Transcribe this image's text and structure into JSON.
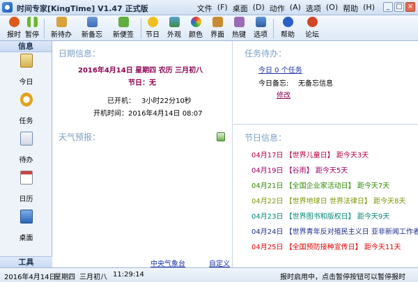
{
  "window": {
    "title": "时间专家[KingTime] V1.47 正式版",
    "menu": [
      "文件",
      "桌面",
      "动作",
      "选项",
      "帮助"
    ],
    "controls": {
      "minimize": "_",
      "maximize": "□",
      "close": "×"
    }
  },
  "toolbar": {
    "buttons": [
      {
        "label": "报时",
        "icon": "clock-icon"
      },
      {
        "label": "暂停",
        "icon": "pause-icon"
      },
      {
        "label": "新待办",
        "icon": "new-todo-icon"
      },
      {
        "label": "新备忘",
        "icon": "new-memo-icon"
      },
      {
        "label": "新便签",
        "icon": "new-note-icon"
      },
      {
        "label": "节日",
        "icon": "festival-icon"
      },
      {
        "label": "外观",
        "icon": "appearance-icon"
      },
      {
        "label": "颜色",
        "icon": "palette-icon"
      },
      {
        "label": "界面",
        "icon": "interface-icon"
      },
      {
        "label": "热键",
        "icon": "hotkey-icon"
      },
      {
        "label": "选项",
        "icon": "options-icon"
      },
      {
        "label": "帮助",
        "icon": "help-icon"
      },
      {
        "label": "论坛",
        "icon": "forum-icon"
      }
    ]
  },
  "sidebar": {
    "header": "信息",
    "footer": "工具",
    "items": [
      {
        "label": "今日",
        "icon": "clipboard-icon"
      },
      {
        "label": "任务",
        "icon": "clock-task-icon"
      },
      {
        "label": "待办",
        "icon": "todo-icon"
      },
      {
        "label": "日历",
        "icon": "calendar-icon"
      },
      {
        "label": "桌面",
        "icon": "desktop-icon"
      }
    ]
  },
  "date_panel": {
    "title": "日期信息：",
    "date_line": "2016年4月14日  星期四   农历  三月初八",
    "holiday_line": "节日：无",
    "uptime_label": "已开机：",
    "uptime_value": "3小时22分10秒",
    "boot_label": "开机时间：",
    "boot_value": "2016年4月14日  08:07",
    "weather_title": "天气预报：",
    "weather_link": "中央气象台",
    "custom_link": "自定义"
  },
  "task_panel": {
    "title": "任务待办：",
    "today_tasks_link": "今日  0  个任务",
    "memo_label": "今日备忘:",
    "memo_value": "无备忘信息",
    "edit_link": "修改"
  },
  "holiday_panel": {
    "title": "节日信息：",
    "items": [
      {
        "date": "04月17日",
        "name": "【世界儿童日】",
        "countdown": "距今天3天",
        "color": "#b0003a"
      },
      {
        "date": "04月19日",
        "name": "【谷雨】",
        "countdown": "距今天5天",
        "color": "#9b0069"
      },
      {
        "date": "04月21日",
        "name": "【全国企业家活动日】",
        "countdown": "距今天7天",
        "color": "#2e8a00"
      },
      {
        "date": "04月22日",
        "name": "【世界地球日  世界法律日】",
        "countdown": "距今天8天",
        "color": "#7c9400"
      },
      {
        "date": "04月23日",
        "name": "【世界图书和版权日】",
        "countdown": "距今天9天",
        "color": "#008878"
      },
      {
        "date": "04月24日",
        "name": "【世界青年反对殖民主义日  亚非新闻工作者",
        "countdown": "",
        "color": "#1d2f8c"
      },
      {
        "date": "04月25日",
        "name": "【全国预防接种宣传日】",
        "countdown": "距今天11天",
        "color": "#e00000"
      }
    ]
  },
  "statusbar": {
    "date": "2016年4月14日",
    "weekday": "星期四",
    "lunar": "三月初八",
    "time": "11:29:14",
    "message": "报时启用中，点击暂停按钮可以暂停报时"
  },
  "colors": {
    "accent": "#8b0051",
    "section_title": "#7a9ec6",
    "link": "#1a2fa8"
  }
}
